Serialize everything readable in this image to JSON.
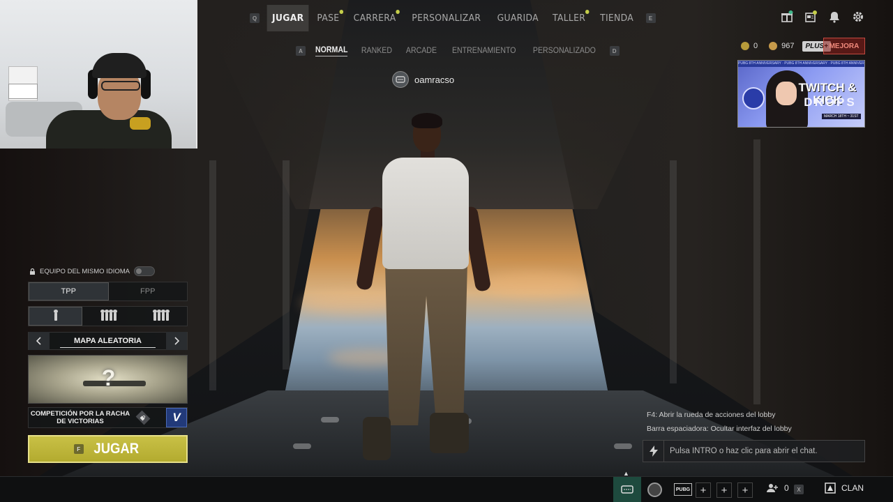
{
  "top_nav": {
    "left_key": "Q",
    "right_key": "E",
    "items": [
      {
        "label": "JUGAR",
        "active": true,
        "dot": false
      },
      {
        "label": "PASE",
        "active": false,
        "dot": true
      },
      {
        "label": "CARRERA",
        "active": false,
        "dot": true
      },
      {
        "label": "PERSONALIZAR",
        "active": false,
        "dot": false
      },
      {
        "label": "GUARIDA",
        "active": false,
        "dot": false
      },
      {
        "label": "TALLER",
        "active": false,
        "dot": true
      },
      {
        "label": "TIENDA",
        "active": false,
        "dot": false
      }
    ]
  },
  "sub_nav": {
    "left_key": "A",
    "right_key": "D",
    "items": [
      {
        "label": "NORMAL",
        "active": true
      },
      {
        "label": "RANKED",
        "active": false
      },
      {
        "label": "ARCADE",
        "active": false
      },
      {
        "label": "ENTRENAMIENTO",
        "active": false
      },
      {
        "label": "PERSONALIZADO",
        "active": false
      }
    ]
  },
  "top_right": {
    "icons": [
      "gift-icon",
      "news-icon",
      "bell-icon",
      "gear-icon"
    ],
    "currency_a": "0",
    "currency_b": "967",
    "plus_badge": "PLUS+",
    "upgrade_label": "MEJORA"
  },
  "promo": {
    "stripe": "PUBG 8TH ANNIVERSARY · PUBG 8TH ANNIVERSARY · PUBG 8TH ANNIVERSARY",
    "title": "TWITCH & KICK",
    "subtitle": "DROPS",
    "date": "MARCH 18TH ~ 31ST"
  },
  "player": {
    "name": "oamracso"
  },
  "lobby": {
    "language_label": "EQUIPO DEL MISMO IDIOMA",
    "perspective": [
      {
        "label": "TPP",
        "active": true
      },
      {
        "label": "FPP",
        "active": false
      }
    ],
    "squad_sizes": [
      {
        "name": "solo",
        "count": 1,
        "active": true
      },
      {
        "name": "duo",
        "count": 4,
        "active": false
      },
      {
        "name": "squad",
        "count": 4,
        "active": false
      }
    ],
    "map_name": "MAPA ALEATORIA",
    "map_placeholder": "?",
    "streak_label": "COMPETICIÓN POR LA RACHA DE VICTORIAS",
    "streak_badge": "V",
    "play_key": "F",
    "play_label": "JUGAR"
  },
  "hints": {
    "line1": "F4: Abrir la rueda de acciones del lobby",
    "line2": "Barra espaciadora: Ocultar interfaz del lobby"
  },
  "chat": {
    "placeholder": "Pulsa INTRO o haz clic para abrir el chat."
  },
  "bottom_bar": {
    "brand": "PUBG",
    "friends_count": "0",
    "clan_label": "CLAN",
    "close_key": "X"
  },
  "colors": {
    "accent_yellow": "#c8c046",
    "chat_green": "#1e4a3e",
    "upgrade_red": "#c24a40",
    "badge_blue": "#223a7a"
  }
}
